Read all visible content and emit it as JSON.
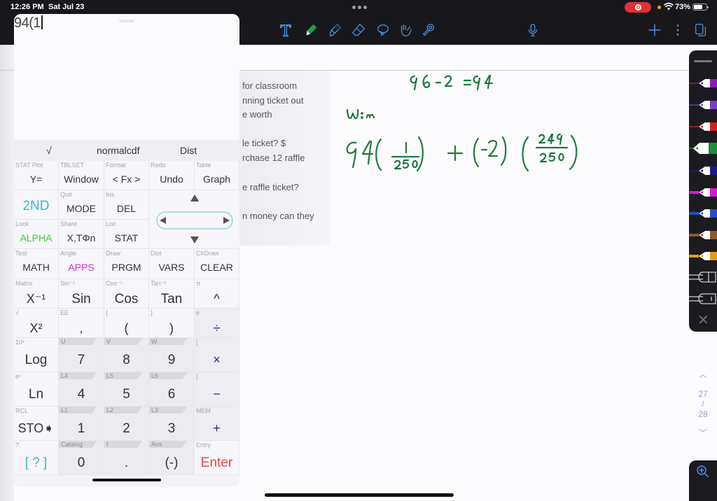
{
  "status_bar": {
    "time": "12:26 PM",
    "date": "Sat Jul 23",
    "battery_percent": "73%",
    "battery_level": 0.73,
    "recording": true
  },
  "toolbar": {
    "tools": [
      {
        "name": "text-tool",
        "icon": "text-icon"
      },
      {
        "name": "pen-tool",
        "icon": "pen-icon",
        "active": true,
        "color": "#1e9e4a"
      },
      {
        "name": "highlighter-tool",
        "icon": "highlighter-icon"
      },
      {
        "name": "eraser-tool",
        "icon": "eraser-icon"
      },
      {
        "name": "lasso-tool",
        "icon": "lasso-icon"
      },
      {
        "name": "hand-tool",
        "icon": "hand-icon"
      },
      {
        "name": "laser-tool",
        "icon": "laser-pointer-icon"
      }
    ],
    "right_tools": [
      {
        "name": "microphone",
        "icon": "microphone-icon"
      },
      {
        "name": "add",
        "icon": "plus-icon"
      },
      {
        "name": "more",
        "icon": "more-vertical-icon"
      },
      {
        "name": "pages",
        "icon": "pages-icon"
      }
    ],
    "accent": "#4a90e2"
  },
  "problem_text": [
    " for classroom",
    "nning ticket out",
    "e worth",
    "",
    "le ticket? $",
    "rchase 12 raffle",
    "",
    "e raffle ticket?",
    "",
    "n money can they"
  ],
  "handwriting": {
    "color": "#1e7a3c",
    "lines": [
      "96 - 2 = 94",
      "W:n",
      "94(1/250) + (-2)(249/250)"
    ]
  },
  "palette": {
    "pens": [
      {
        "color": "#8e1bb5"
      },
      {
        "color": "#7b3fc4"
      },
      {
        "color": "#d62020"
      },
      {
        "color": "#1a8f3a",
        "selected": true
      },
      {
        "color": "#1b1b8c"
      },
      {
        "color": "#d81ad8"
      },
      {
        "color": "#1f4fc9"
      },
      {
        "color": "#8a5a2c"
      },
      {
        "color": "#e89a1a"
      }
    ],
    "close_label": "✕"
  },
  "pager": {
    "current": "27",
    "separator": "/",
    "total": "28"
  },
  "calculator": {
    "expression": "94(1",
    "function_row": [
      "√",
      "normalcdf",
      "Dist"
    ],
    "rows": [
      [
        {
          "sec": "STAT Plot",
          "main": "Y="
        },
        {
          "sec": "TBLSET",
          "main": "Window"
        },
        {
          "sec": "Format",
          "main": "< Fx >"
        },
        {
          "sec": "Redo",
          "main": "Undo"
        },
        {
          "sec": "Table",
          "main": "Graph"
        }
      ],
      [
        {
          "sec": "",
          "main": "2ND",
          "color": "#3fb6d6"
        },
        {
          "sec": "Quit",
          "main": "MODE"
        },
        {
          "sec": "Ins",
          "main": "DEL"
        }
      ],
      [
        {
          "sec": "Lock",
          "main": "ALPHA",
          "color": "#3ec93e"
        },
        {
          "sec": "Share",
          "main": "X,TΦn"
        },
        {
          "sec": "List",
          "main": "STAT"
        }
      ],
      [
        {
          "sec": "Test",
          "main": "MATH"
        },
        {
          "sec": "Angle",
          "main": "APPS",
          "color": "#d22fd6"
        },
        {
          "sec": "Draw",
          "main": "PRGM"
        },
        {
          "sec": "Dist",
          "main": "VARS"
        },
        {
          "sec": "ClrDraw",
          "main": "CLEAR"
        }
      ],
      [
        {
          "sec": "Matrix",
          "main": "X⁻¹"
        },
        {
          "sec": "Sin⁻¹",
          "main": "Sin"
        },
        {
          "sec": "Cos⁻¹",
          "main": "Cos"
        },
        {
          "sec": "Tan⁻¹",
          "main": "Tan"
        },
        {
          "sec": "π",
          "main": "^"
        }
      ],
      [
        {
          "sec": "√",
          "main": "X²"
        },
        {
          "sec": "EE",
          "main": ","
        },
        {
          "sec": "{",
          "main": "("
        },
        {
          "sec": "}",
          "main": ")"
        },
        {
          "sec": "e",
          "main": "÷",
          "color": "#2b2b8a"
        }
      ],
      [
        {
          "sec": "10ˣ",
          "main": "Log"
        },
        {
          "sec": "U",
          "main": "7",
          "tab": true
        },
        {
          "sec": "V",
          "main": "8",
          "tab": true
        },
        {
          "sec": "W",
          "main": "9",
          "tab": true
        },
        {
          "sec": "[",
          "main": "×",
          "color": "#2b2b8a"
        }
      ],
      [
        {
          "sec": "eˣ",
          "main": "Ln"
        },
        {
          "sec": "L4",
          "main": "4",
          "tab": true
        },
        {
          "sec": "L5",
          "main": "5",
          "tab": true
        },
        {
          "sec": "L6",
          "main": "6",
          "tab": true
        },
        {
          "sec": "]",
          "main": "−",
          "color": "#2b2b8a"
        }
      ],
      [
        {
          "sec": "RCL",
          "main": "STO➧"
        },
        {
          "sec": "L1",
          "main": "1",
          "tab": true
        },
        {
          "sec": "L2",
          "main": "2",
          "tab": true
        },
        {
          "sec": "L3",
          "main": "3",
          "tab": true
        },
        {
          "sec": "MEM",
          "main": "+",
          "color": "#2b2b8a"
        }
      ],
      [
        {
          "sec": "?.",
          "main": "[ ? ]",
          "color": "#3fb6d6"
        },
        {
          "sec": "Catalog",
          "main": "0",
          "tab": true
        },
        {
          "sec": "I",
          "main": ".",
          "tab": true
        },
        {
          "sec": "Ans",
          "main": "(-)",
          "tab": true
        },
        {
          "sec": "Entry",
          "main": "Enter",
          "color": "#e0484c"
        }
      ]
    ]
  }
}
